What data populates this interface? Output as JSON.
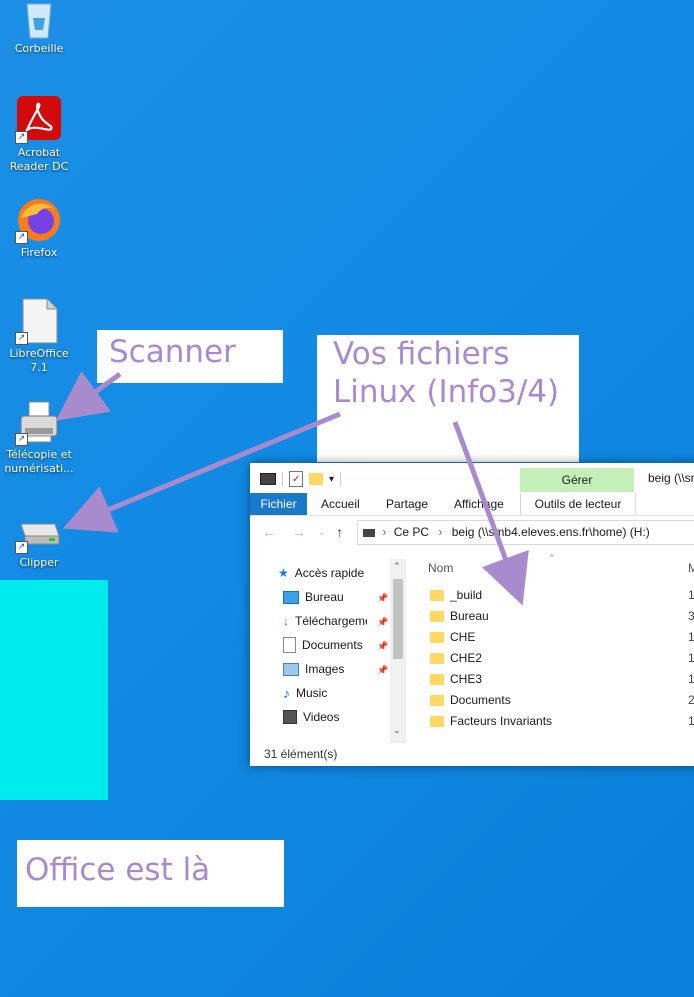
{
  "desktop": {
    "icons": [
      {
        "label": "Corbeille"
      },
      {
        "label": "Acrobat Reader DC"
      },
      {
        "label": "Firefox"
      },
      {
        "label": "LibreOffice 7.1"
      },
      {
        "label": "Télécopie et numérisati..."
      },
      {
        "label": "Clipper"
      }
    ]
  },
  "callouts": {
    "scanner": "Scanner",
    "linux": "Vos fichiers Linux (Info3/4)",
    "office": "Office est là"
  },
  "explorer": {
    "title": "beig (\\\\sr",
    "manage_tab": "Gérer",
    "ribbon_tabs": [
      "Fichier",
      "Accueil",
      "Partage",
      "Affichage",
      "Outils de lecteur"
    ],
    "address": [
      "Ce PC",
      "beig (\\\\smb4.eleves.ens.fr\\home) (H:)"
    ],
    "nav": [
      {
        "label": "Accès rapide"
      },
      {
        "label": "Bureau"
      },
      {
        "label": "Téléchargeme"
      },
      {
        "label": "Documents"
      },
      {
        "label": "Images"
      },
      {
        "label": "Music"
      },
      {
        "label": "Videos"
      }
    ],
    "column_name": "Nom",
    "column_next": "M",
    "files": [
      {
        "name": "_build",
        "extra": "1"
      },
      {
        "name": "Bureau",
        "extra": "3"
      },
      {
        "name": "CHE",
        "extra": "1"
      },
      {
        "name": "CHE2",
        "extra": "1"
      },
      {
        "name": "CHE3",
        "extra": "1"
      },
      {
        "name": "Documents",
        "extra": "2"
      },
      {
        "name": "Facteurs Invariants",
        "extra": "1"
      }
    ],
    "status": "31 élément(s)"
  },
  "colors": {
    "desktop": "#118ae3",
    "callout_text": "#a78bcc",
    "arrow": "#a78bcc",
    "cyan": "#00ecec",
    "manage": "#c5efb8",
    "file_tab": "#1979ca"
  }
}
